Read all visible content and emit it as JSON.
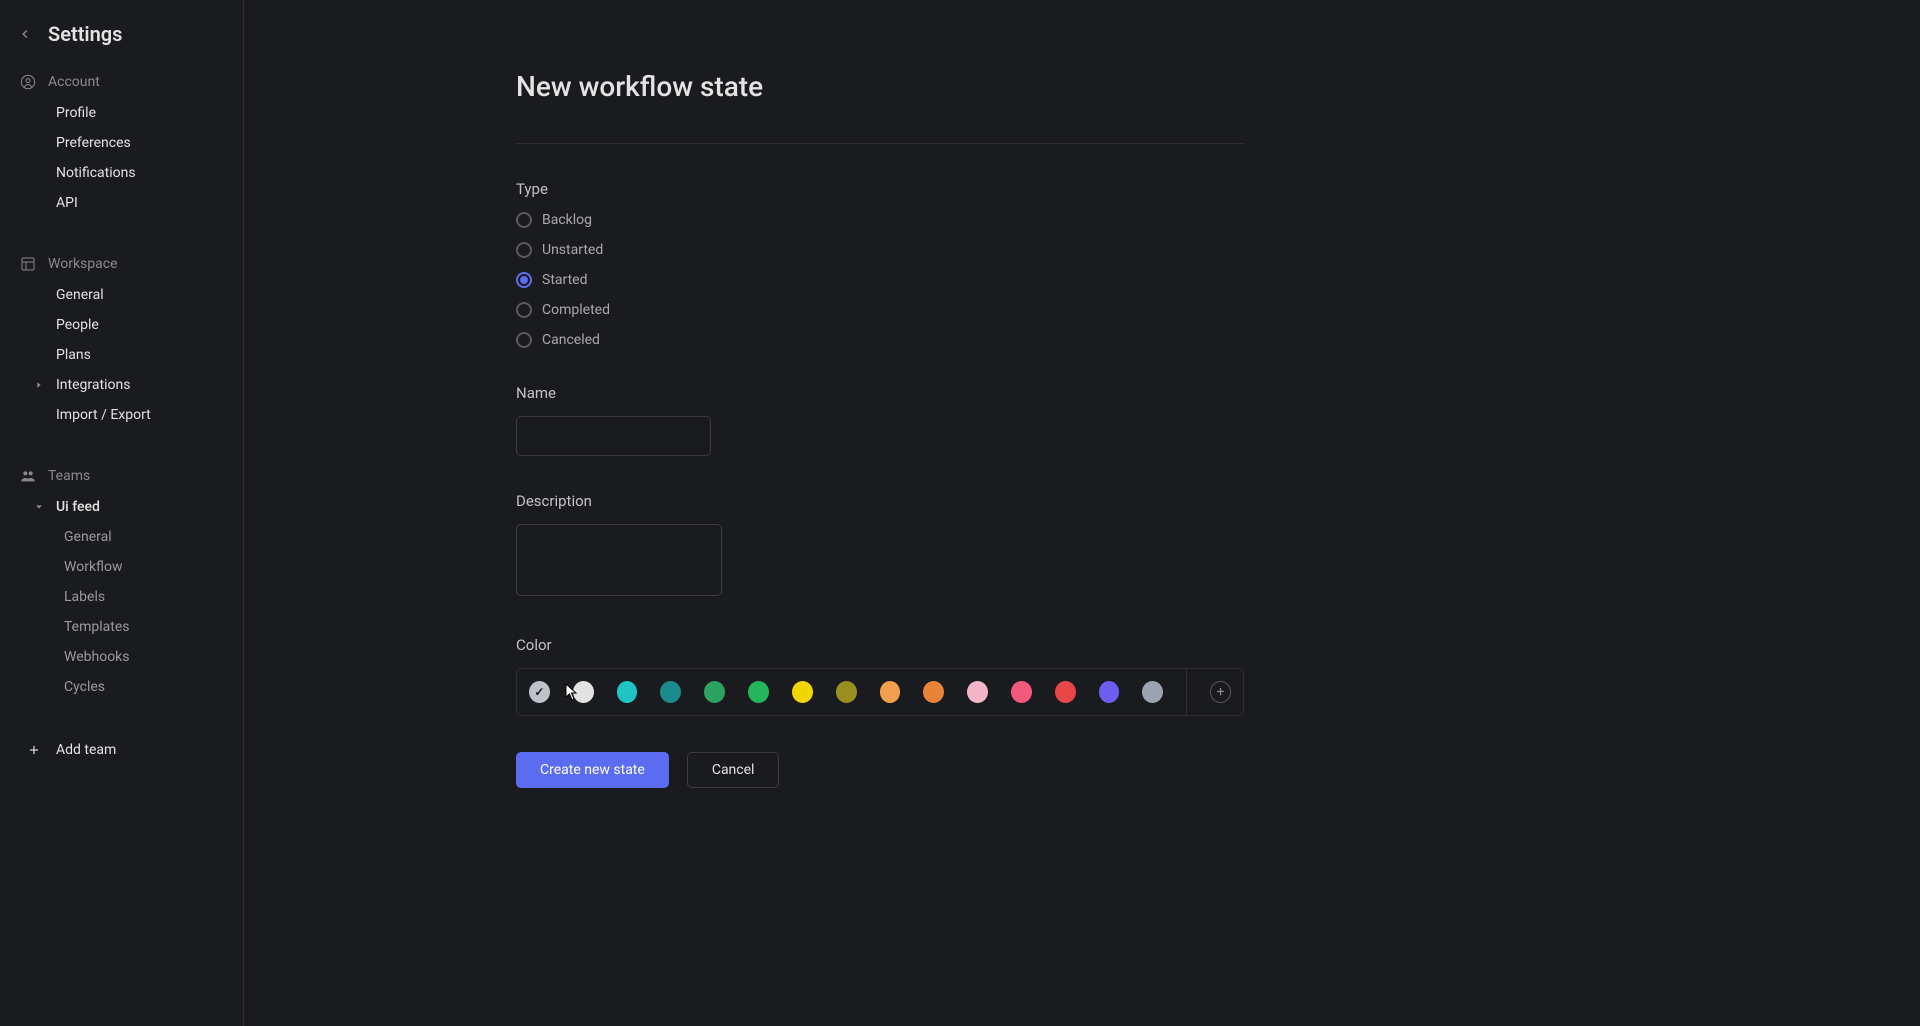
{
  "sidebar": {
    "title": "Settings",
    "account": {
      "label": "Account",
      "items": [
        "Profile",
        "Preferences",
        "Notifications",
        "API"
      ]
    },
    "workspace": {
      "label": "Workspace",
      "items": [
        "General",
        "People",
        "Plans",
        "Integrations",
        "Import / Export"
      ]
    },
    "teams": {
      "label": "Teams",
      "team_name": "Ui feed",
      "items": [
        "General",
        "Workflow",
        "Labels",
        "Templates",
        "Webhooks",
        "Cycles"
      ]
    },
    "add_team": "Add team"
  },
  "main": {
    "title": "New workflow state",
    "type": {
      "label": "Type",
      "options": [
        "Backlog",
        "Unstarted",
        "Started",
        "Completed",
        "Canceled"
      ],
      "selected": "Started"
    },
    "name": {
      "label": "Name",
      "value": ""
    },
    "description": {
      "label": "Description",
      "value": ""
    },
    "color": {
      "label": "Color",
      "options": [
        "#bec2c8",
        "#e2e2e2",
        "#1fc5c5",
        "#1b8a8a",
        "#2da160",
        "#26b55c",
        "#f2d600",
        "#9a8e1e",
        "#f29e4c",
        "#e8833a",
        "#f5b5c8",
        "#f25a7b",
        "#e84646",
        "#6c5ef0",
        "#9ca3b0"
      ],
      "selected": 0
    },
    "buttons": {
      "create": "Create new state",
      "cancel": "Cancel"
    }
  }
}
